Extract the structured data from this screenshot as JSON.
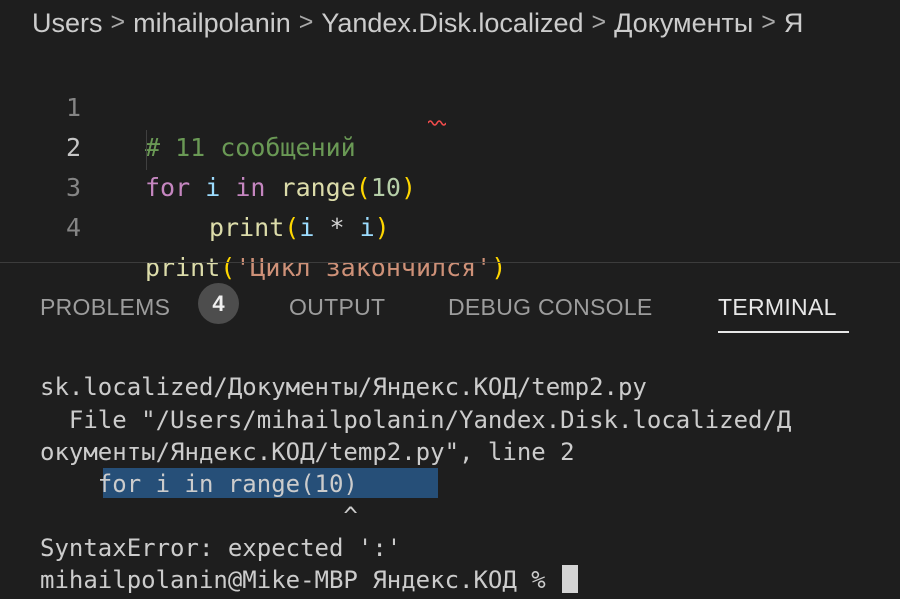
{
  "breadcrumb": {
    "items": [
      "Users",
      "mihailpolanin",
      "Yandex.Disk.localized",
      "Документы",
      "Я"
    ],
    "separator": ">"
  },
  "editor": {
    "lines": [
      {
        "number": "1",
        "comment": "# 11 сообщений"
      },
      {
        "number": "2",
        "kw_for": "for",
        "var": "i",
        "kw_in": "in",
        "fn": "range",
        "open": "(",
        "num": "10",
        "close": ")"
      },
      {
        "number": "3",
        "fn": "print",
        "open": "(",
        "var1": "i",
        "op": "*",
        "var2": "i",
        "close": ")"
      },
      {
        "number": "4",
        "fn": "print",
        "open": "(",
        "str": "'Цикл закончился'",
        "close": ")"
      }
    ]
  },
  "panel": {
    "tabs": [
      {
        "label": "PROBLEMS",
        "badge": "4"
      },
      {
        "label": "OUTPUT"
      },
      {
        "label": "DEBUG CONSOLE"
      },
      {
        "label": "TERMINAL",
        "active": true
      }
    ]
  },
  "terminal": {
    "lines": [
      "sk.localized/Документы/Яндекс.КОД/temp2.py",
      "  File \"/Users/mihailpolanin/Yandex.Disk.localized/Д",
      "окументы/Яндекс.КОД/temp2.py\", line 2",
      "    for i in range(10)",
      "                     ^",
      "SyntaxError: expected ':'",
      "mihailpolanin@Mike-MBP Яндекс.КОД % "
    ]
  },
  "colors": {
    "background": "#1e1e1e",
    "comment": "#6a9955",
    "keyword": "#c586c0",
    "function": "#dcdcaa",
    "string": "#ce9178",
    "selection": "#264f78"
  }
}
